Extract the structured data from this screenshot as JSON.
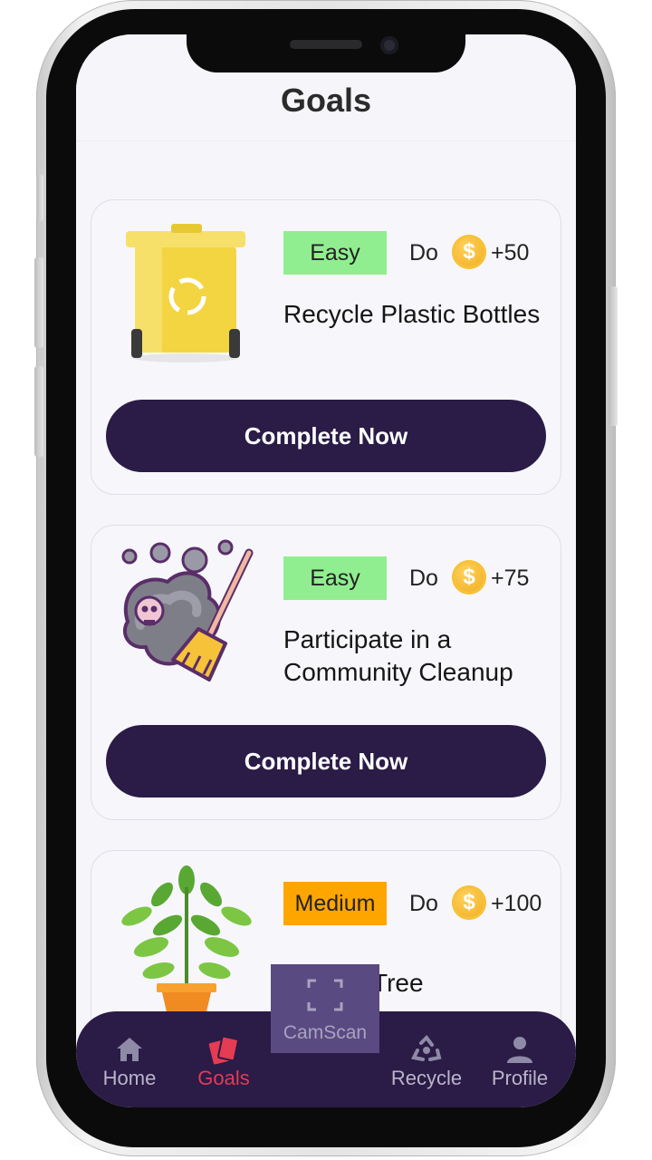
{
  "header": {
    "title": "Goals"
  },
  "goals": [
    {
      "difficulty": "Easy",
      "difficulty_color": "#90ee90",
      "do_label": "Do",
      "coin_symbol": "$",
      "reward": "+50",
      "title": "Recycle Plastic Bottles",
      "button_label": "Complete Now",
      "art_icon": "recycle-bin-icon"
    },
    {
      "difficulty": "Easy",
      "difficulty_color": "#90ee90",
      "do_label": "Do",
      "coin_symbol": "$",
      "reward": "+75",
      "title": "Participate in a Community Cleanup",
      "button_label": "Complete Now",
      "art_icon": "smoke-broom-icon"
    },
    {
      "difficulty": "Medium",
      "difficulty_color": "#ffa500",
      "do_label": "Do",
      "coin_symbol": "$",
      "reward": "+100",
      "title": "Tree",
      "art_icon": "potted-plant-icon"
    }
  ],
  "nav": {
    "items": [
      {
        "label": "Home",
        "icon": "home-icon"
      },
      {
        "label": "Goals",
        "icon": "cards-icon",
        "active": true
      },
      {
        "label": "Recycle",
        "icon": "recycle-icon"
      },
      {
        "label": "Profile",
        "icon": "person-icon"
      }
    ],
    "camscan": {
      "label": "CamScan",
      "icon": "scan-frame-icon"
    }
  },
  "colors": {
    "primary": "#2a1b47",
    "active_nav": "#e53b53",
    "coin": "#f0a81c",
    "camscan_bg": "#5a4a82"
  }
}
